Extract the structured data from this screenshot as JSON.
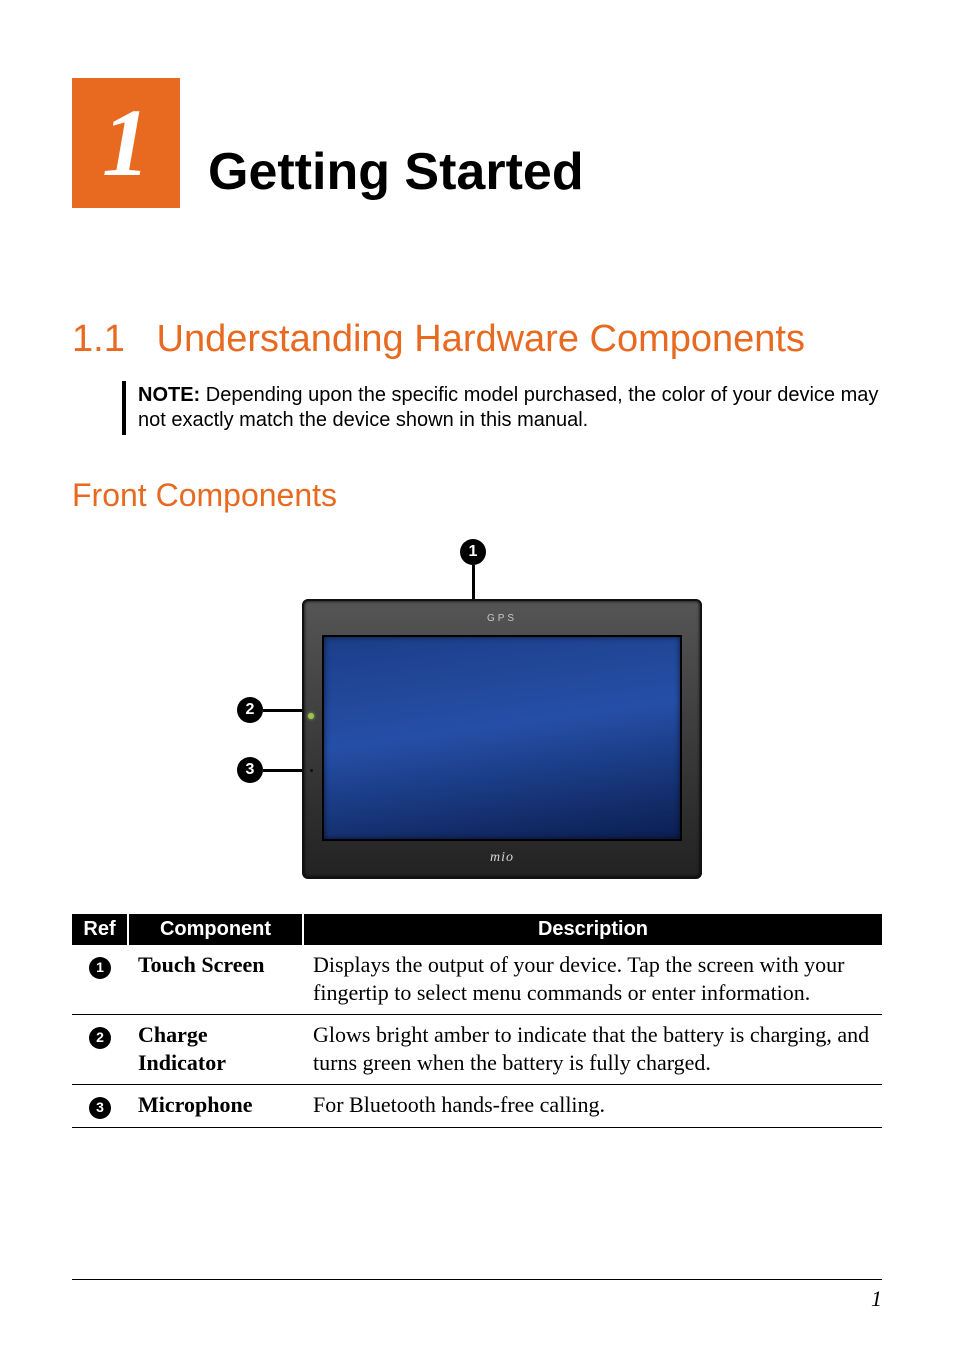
{
  "chapter": {
    "number": "1",
    "title": "Getting Started"
  },
  "section": {
    "number": "1.1",
    "title": "Understanding Hardware Components"
  },
  "note": {
    "label": "NOTE:",
    "text": "Depending upon the specific model purchased, the color of your device may not exactly match the device shown in this manual."
  },
  "sub_heading": "Front Components",
  "diagram": {
    "callouts": [
      "1",
      "2",
      "3"
    ],
    "top_label": "GPS",
    "bottom_label": "mio"
  },
  "table": {
    "headers": {
      "ref": "Ref",
      "component": "Component",
      "description": "Description"
    },
    "rows": [
      {
        "ref": "1",
        "component": "Touch Screen",
        "description": "Displays the output of your device. Tap the screen with your fingertip to select menu commands or enter information."
      },
      {
        "ref": "2",
        "component": "Charge Indicator",
        "description": "Glows bright amber to indicate that the battery is charging, and turns green when the battery is fully charged."
      },
      {
        "ref": "3",
        "component": "Microphone",
        "description": "For Bluetooth hands-free calling."
      }
    ]
  },
  "page_number": "1"
}
